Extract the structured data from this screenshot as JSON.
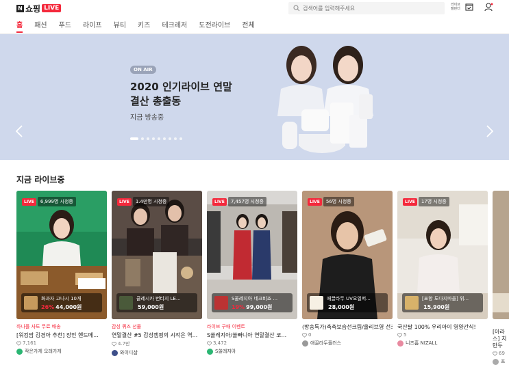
{
  "header": {
    "logo_n": "N",
    "logo_text": "쇼핑",
    "logo_live": "LIVE",
    "search_placeholder": "검색어를 입력해주세요",
    "recommend_label": "라이브 캘린더"
  },
  "nav": [
    "홈",
    "패션",
    "푸드",
    "라이프",
    "뷰티",
    "키즈",
    "테크레저",
    "도전라이브",
    "전체"
  ],
  "banner": {
    "badge": "ON AIR",
    "title": "2020 인기라이브 연말결산 총출동",
    "subtitle": "지금 방송중"
  },
  "section_title": "지금 라이브중",
  "live_label": "LIVE",
  "cards": [
    {
      "viewers": "6,999명 시청중",
      "product": "화과자 고나시 10개",
      "discount": "26%",
      "price": "44,000원",
      "tag": "하나플 사도 무료 배송",
      "title": "[워킹맘 김경아 추천] 장인 핸드메...",
      "likes": "7,161",
      "seller": "작은가게 오래가게",
      "thumb_text": "작은가게"
    },
    {
      "viewers": "1.4만명 시청중",
      "product": "클레시카 번티지 LE...",
      "discount": "",
      "price": "59,000원",
      "tag": "감성 퀴즈 선물",
      "title": "연말결산 #5 감성캠핑의 시작은 역...",
      "likes": "4.7만",
      "seller": "와이디샵",
      "thumb_text": ""
    },
    {
      "viewers": "7,457명 시청중",
      "product": "S울레지아 네크비죠 ...",
      "discount": "19%",
      "price": "99,000원",
      "tag": "라이브 구매 이벤트",
      "title": "S쏠레지아/쏠빠니아 연말결산 코...",
      "likes": "3,472",
      "seller": "S쏠레지아",
      "thumb_text": ""
    },
    {
      "viewers": "56명 시청중",
      "product": "애끌라두 UV오일퍼...",
      "discount": "",
      "price": "28,000원",
      "tag": "",
      "title": "(방송특가)촉촉보습선크림/올리브영 선크림추천/비비크림",
      "likes": "0",
      "seller": "애끌라두플러스",
      "thumb_text": ""
    },
    {
      "viewers": "17명 시청중",
      "product": "[포항 도다지마을] 위...",
      "discount": "",
      "price": "15,900원",
      "tag": "",
      "title": "국산팔 100% 우리아이 영양간식!",
      "likes": "5",
      "seller": "니즈홈 NIZALL",
      "thumb_text": ""
    },
    {
      "viewers": "",
      "product": "",
      "discount": "",
      "price": "",
      "tag": "",
      "title": "[아라스] 치만두",
      "likes": "69",
      "seller": "프",
      "thumb_text": ""
    }
  ],
  "colors": {
    "accent": "#f4293c",
    "banner_bg": "#cfd8ec"
  }
}
